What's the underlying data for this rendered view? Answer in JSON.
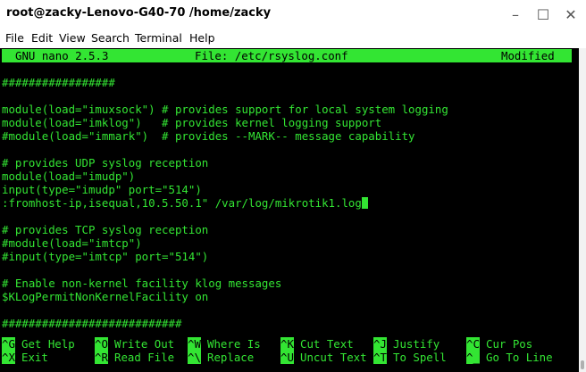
{
  "window": {
    "title": "root@zacky-Lenovo-G40-70 /home/zacky",
    "minimize_glyph": "–",
    "maximize_glyph": "☐",
    "close_glyph": "✕"
  },
  "menu": [
    "File",
    "Edit",
    "View",
    "Search",
    "Terminal",
    "Help"
  ],
  "nano": {
    "version": "GNU nano 2.5.3",
    "file_label": "File: /etc/rsyslog.conf",
    "status": "Modified"
  },
  "content": {
    "lines": [
      "",
      "#################",
      "",
      "module(load=\"imuxsock\") # provides support for local system logging",
      "module(load=\"imklog\")   # provides kernel logging support",
      "#module(load=\"immark\")  # provides --MARK-- message capability",
      "",
      "# provides UDP syslog reception",
      "module(load=\"imudp\")",
      "input(type=\"imudp\" port=\"514\")",
      ":fromhost-ip,isequal,10.5.50.1\" /var/log/mikrotik1.log",
      "",
      "# provides TCP syslog reception",
      "#module(load=\"imtcp\")",
      "#input(type=\"imtcp\" port=\"514\")",
      "",
      "# Enable non-kernel facility klog messages",
      "$KLogPermitNonKernelFacility on",
      "",
      "###########################"
    ],
    "cursor_line": 10
  },
  "shortcuts": {
    "row1": [
      {
        "key": "^G",
        "label": "Get Help"
      },
      {
        "key": "^O",
        "label": "Write Out"
      },
      {
        "key": "^W",
        "label": "Where Is"
      },
      {
        "key": "^K",
        "label": "Cut Text"
      },
      {
        "key": "^J",
        "label": "Justify"
      },
      {
        "key": "^C",
        "label": "Cur Pos"
      }
    ],
    "row2": [
      {
        "key": "^X",
        "label": "Exit"
      },
      {
        "key": "^R",
        "label": "Read File"
      },
      {
        "key": "^\\",
        "label": "Replace"
      },
      {
        "key": "^U",
        "label": "Uncut Text"
      },
      {
        "key": "^T",
        "label": "To Spell"
      },
      {
        "key": "^_",
        "label": "Go To Line"
      }
    ]
  },
  "colors": {
    "terminal_bg": "#000000",
    "terminal_fg": "#33e533"
  }
}
